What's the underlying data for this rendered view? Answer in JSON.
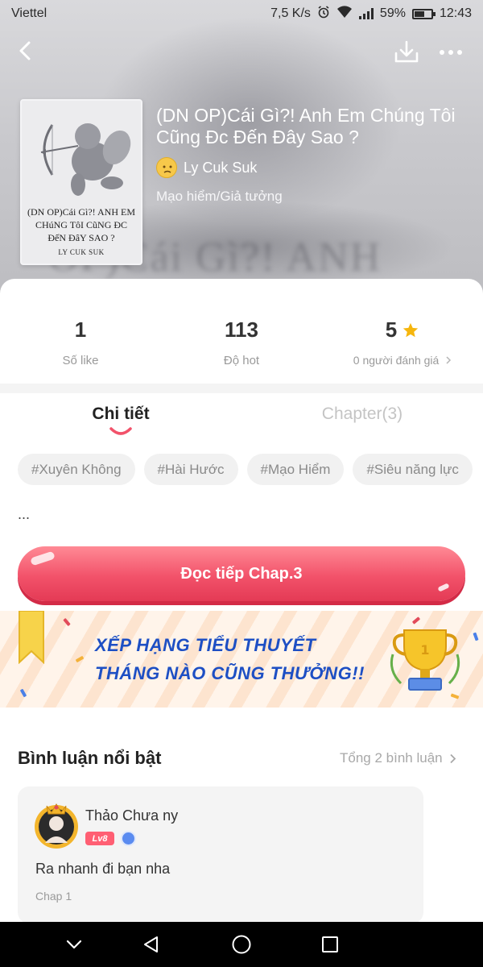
{
  "status_bar": {
    "carrier": "Viettel",
    "speed": "7,5 K/s",
    "battery": "59%",
    "battery_level": 0.59,
    "time": "12:43"
  },
  "book": {
    "title": "(DN OP)Cái Gì?! Anh Em Chúng Tôi Cũng Đc Đến Đây Sao ?",
    "author": "Ly Cuk Suk",
    "genre": "Mạo hiểm/Giả tưởng",
    "cover_title": "(DN OP)Cái Gì?! ANH EM CHúNG TôI CũNG ĐC ĐếN ĐâY SAO ?",
    "cover_author": "LY CUK SUK"
  },
  "stats": {
    "likes_value": "1",
    "likes_label": "Số like",
    "hot_value": "113",
    "hot_label": "Độ hot",
    "rating_value": "5",
    "rating_label": "0 người đánh giá"
  },
  "tabs": {
    "detail": "Chi tiết",
    "chapter": "Chapter(3)"
  },
  "tags": [
    "#Xuyên Không",
    "#Hài Hước",
    "#Mạo Hiểm",
    "#Siêu năng lực"
  ],
  "description": "...",
  "read_button": "Đọc tiếp Chap.3",
  "banner": {
    "line1": "XẾP HẠNG TIỂU THUYẾT",
    "line2": "THÁNG NÀO CŨNG THƯỞNG!!"
  },
  "comments": {
    "title": "Bình luận nổi bật",
    "total": "Tổng 2 bình luận",
    "items": [
      {
        "user": "Thảo Chưa ny",
        "level": "Lv8",
        "text": "Ra nhanh đi bạn nha",
        "chapter": "Chap 1"
      }
    ]
  },
  "colors": {
    "accent": "#f2526a",
    "banner_text": "#1d4fc4",
    "star": "#f6b60d"
  },
  "icons": [
    "back-icon",
    "download-icon",
    "more-icon",
    "star-icon",
    "chevron-right-icon",
    "nav-back-icon",
    "nav-home-icon",
    "nav-recents-icon",
    "nav-hide-icon"
  ]
}
